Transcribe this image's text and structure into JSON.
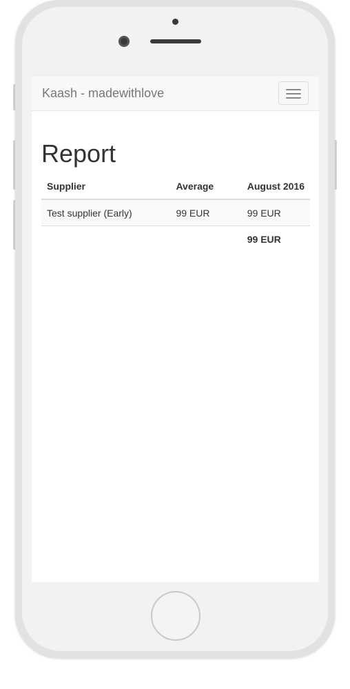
{
  "navbar": {
    "brand": "Kaash - madewithlove",
    "menu_icon": "hamburger-menu-icon"
  },
  "page": {
    "title": "Report"
  },
  "table": {
    "headers": [
      "Supplier",
      "Average",
      "August 2016"
    ],
    "rows": [
      [
        "Test supplier (Early)",
        "99 EUR",
        "99 EUR"
      ]
    ],
    "total": "99 EUR"
  },
  "colors": {
    "navbar_bg": "#f8f8f8",
    "brand_text": "#777777",
    "text": "#333333",
    "striped_row": "#f9f9f9",
    "border": "#dddddd"
  }
}
